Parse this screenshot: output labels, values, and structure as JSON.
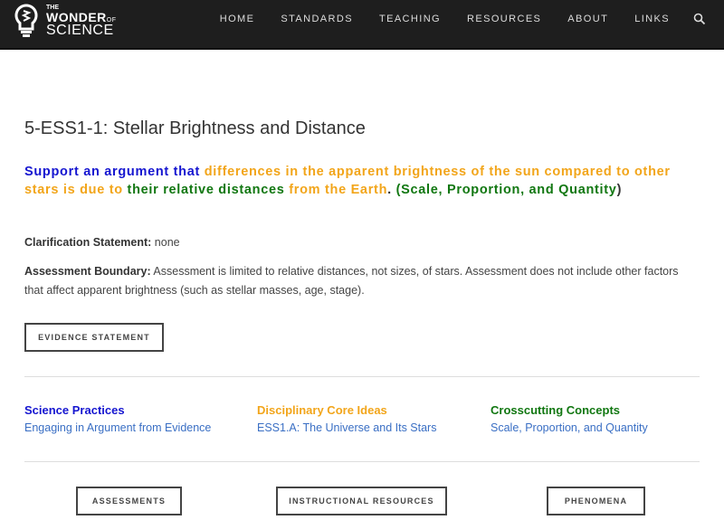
{
  "logo": {
    "line1": "THE",
    "line2": "WONDER",
    "line2_small": "OF",
    "line3": "SCIENCE"
  },
  "nav": [
    "HOME",
    "STANDARDS",
    "TEACHING",
    "RESOURCES",
    "ABOUT",
    "LINKS"
  ],
  "title": "5-ESS1-1: Stellar Brightness and Distance",
  "pe": {
    "p1": "Support an argument that ",
    "p2": "differences in the apparent brightness of the sun compared to other stars is due to ",
    "p3": "their relative distances ",
    "p4": "from the Earth",
    "p5": ". ",
    "p6": "(Scale, Proportion, and Quantity",
    "p7": ")"
  },
  "clarification": {
    "label": "Clarification Statement:",
    "text": " none"
  },
  "boundary": {
    "label": "Assessment Boundary:",
    "text": " Assessment is limited to relative distances, not sizes, of stars. Assessment does not include other factors that affect apparent brightness (such as stellar masses, age, stage)."
  },
  "evidence_button": "EVIDENCE STATEMENT",
  "columns": [
    {
      "heading": "Science Practices",
      "link": "Engaging in Argument from Evidence",
      "color": "#1515d0"
    },
    {
      "heading": "Disciplinary Core Ideas",
      "link": "ESS1.A: The Universe and Its Stars",
      "color": "#f2a51a"
    },
    {
      "heading": "Crosscutting Concepts",
      "link": "Scale, Proportion, and Quantity",
      "color": "#117711"
    }
  ],
  "bottom_buttons": [
    "ASSESSMENTS",
    "INSTRUCTIONAL RESOURCES",
    "PHENOMENA"
  ]
}
